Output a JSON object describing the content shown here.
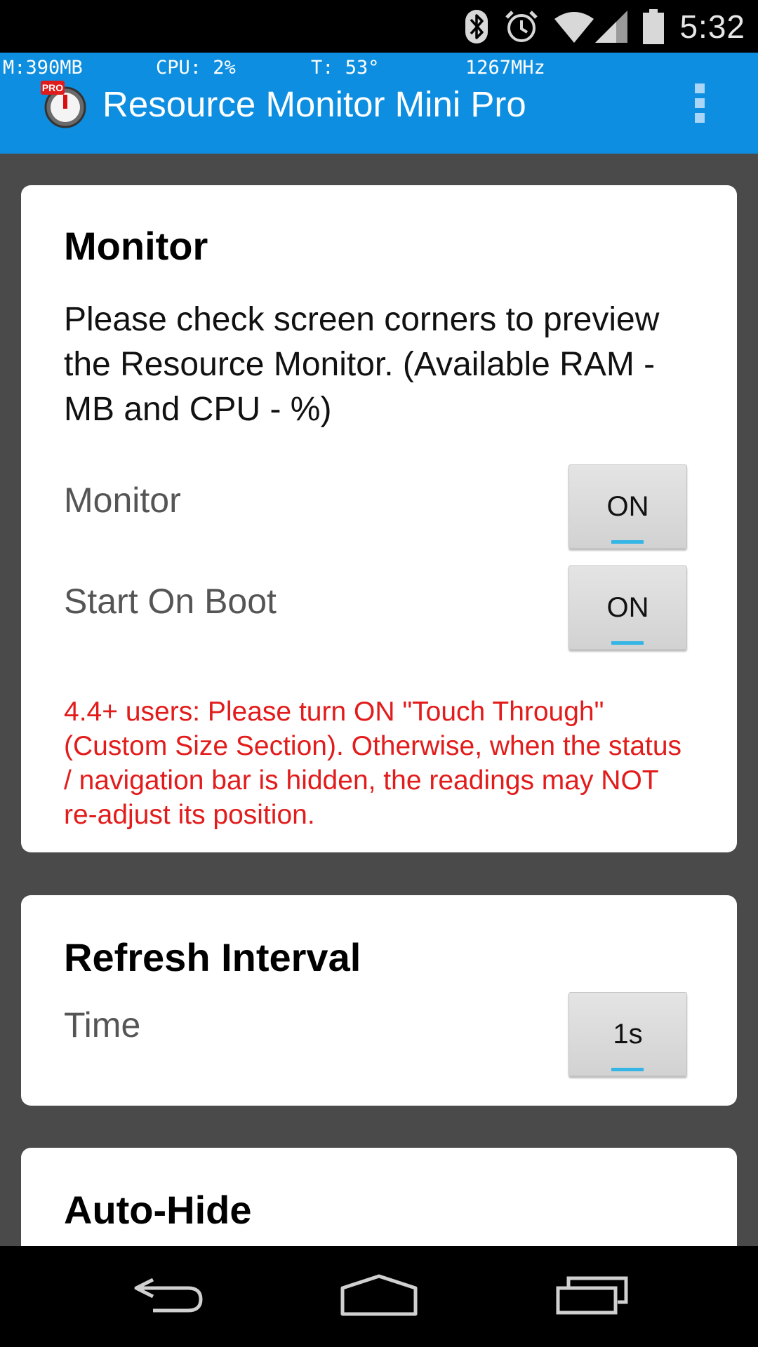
{
  "status_bar": {
    "time": "5:32",
    "icons": [
      "bluetooth-icon",
      "alarm-icon",
      "wifi-icon",
      "cell-signal-icon",
      "battery-icon"
    ]
  },
  "overlay": {
    "ram": "M:390MB",
    "cpu": "CPU: 2%",
    "temp": "T: 53°",
    "freq": "1267MHz"
  },
  "app_bar": {
    "title": "Resource Monitor Mini Pro",
    "badge": "PRO",
    "colors": {
      "background": "#0d8ee0"
    }
  },
  "monitor_card": {
    "title": "Monitor",
    "description": "Please check screen corners to preview the Resource Monitor. (Available RAM - MB and CPU - %)",
    "rows": [
      {
        "label": "Monitor",
        "value": "ON"
      },
      {
        "label": "Start On Boot",
        "value": "ON"
      }
    ],
    "warning": "4.4+ users: Please turn ON \"Touch Through\" (Custom Size Section). Otherwise, when the status / navigation bar is hidden, the readings may NOT re-adjust its position.",
    "warning_color": "#e21b1b"
  },
  "refresh_card": {
    "title": "Refresh Interval",
    "rows": [
      {
        "label": "Time",
        "value": "1s"
      }
    ]
  },
  "autohide_card": {
    "title": "Auto-Hide"
  },
  "nav_bar": {
    "buttons": [
      "back-icon",
      "home-icon",
      "recents-icon"
    ]
  }
}
